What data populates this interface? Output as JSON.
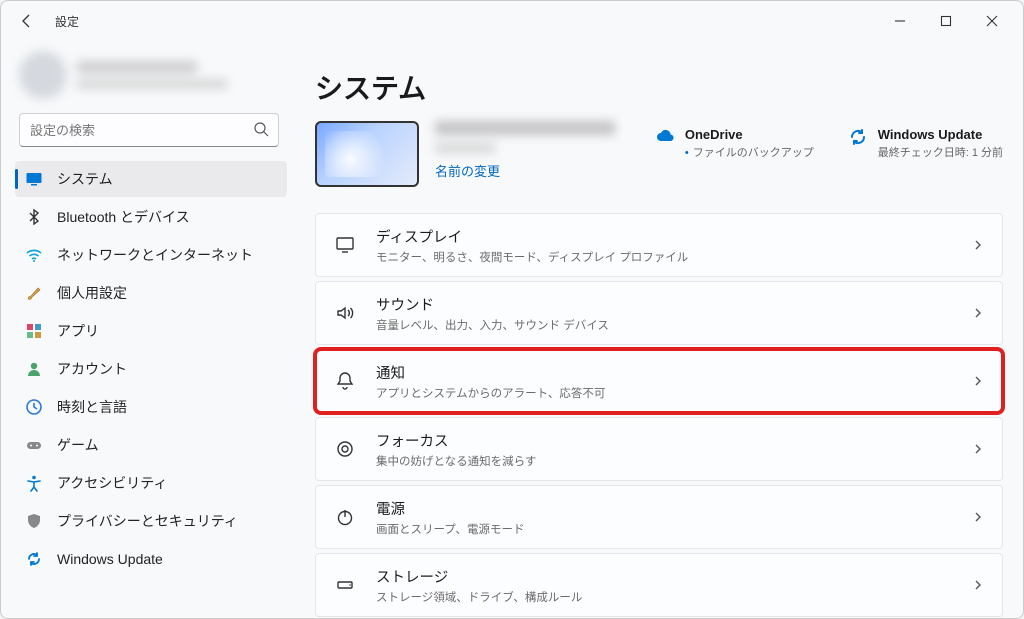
{
  "window": {
    "title": "設定"
  },
  "search": {
    "placeholder": "設定の検索"
  },
  "sidebar": {
    "items": [
      {
        "label": "システム",
        "data_name": "nav-system",
        "icon": "system"
      },
      {
        "label": "Bluetooth とデバイス",
        "data_name": "nav-bluetooth",
        "icon": "bluetooth"
      },
      {
        "label": "ネットワークとインターネット",
        "data_name": "nav-network",
        "icon": "wifi"
      },
      {
        "label": "個人用設定",
        "data_name": "nav-personalization",
        "icon": "brush"
      },
      {
        "label": "アプリ",
        "data_name": "nav-apps",
        "icon": "apps"
      },
      {
        "label": "アカウント",
        "data_name": "nav-accounts",
        "icon": "person"
      },
      {
        "label": "時刻と言語",
        "data_name": "nav-time-language",
        "icon": "clock"
      },
      {
        "label": "ゲーム",
        "data_name": "nav-gaming",
        "icon": "game"
      },
      {
        "label": "アクセシビリティ",
        "data_name": "nav-accessibility",
        "icon": "accessibility"
      },
      {
        "label": "プライバシーとセキュリティ",
        "data_name": "nav-privacy",
        "icon": "shield"
      },
      {
        "label": "Windows Update",
        "data_name": "nav-windows-update",
        "icon": "update"
      }
    ]
  },
  "page": {
    "heading": "システム",
    "rename": "名前の変更",
    "onedrive": {
      "title": "OneDrive",
      "sub": "ファイルのバックアップ"
    },
    "update": {
      "title": "Windows Update",
      "sub": "最終チェック日時: 1 分前"
    }
  },
  "cards": [
    {
      "title": "ディスプレイ",
      "sub": "モニター、明るさ、夜間モード、ディスプレイ プロファイル",
      "icon": "display",
      "data_name": "card-display",
      "highlight": false
    },
    {
      "title": "サウンド",
      "sub": "音量レベル、出力、入力、サウンド デバイス",
      "icon": "sound",
      "data_name": "card-sound",
      "highlight": false
    },
    {
      "title": "通知",
      "sub": "アプリとシステムからのアラート、応答不可",
      "icon": "bell",
      "data_name": "card-notifications",
      "highlight": true
    },
    {
      "title": "フォーカス",
      "sub": "集中の妨げとなる通知を減らす",
      "icon": "focus",
      "data_name": "card-focus",
      "highlight": false
    },
    {
      "title": "電源",
      "sub": "画面とスリープ、電源モード",
      "icon": "power",
      "data_name": "card-power",
      "highlight": false
    },
    {
      "title": "ストレージ",
      "sub": "ストレージ領域、ドライブ、構成ルール",
      "icon": "storage",
      "data_name": "card-storage",
      "highlight": false
    }
  ]
}
